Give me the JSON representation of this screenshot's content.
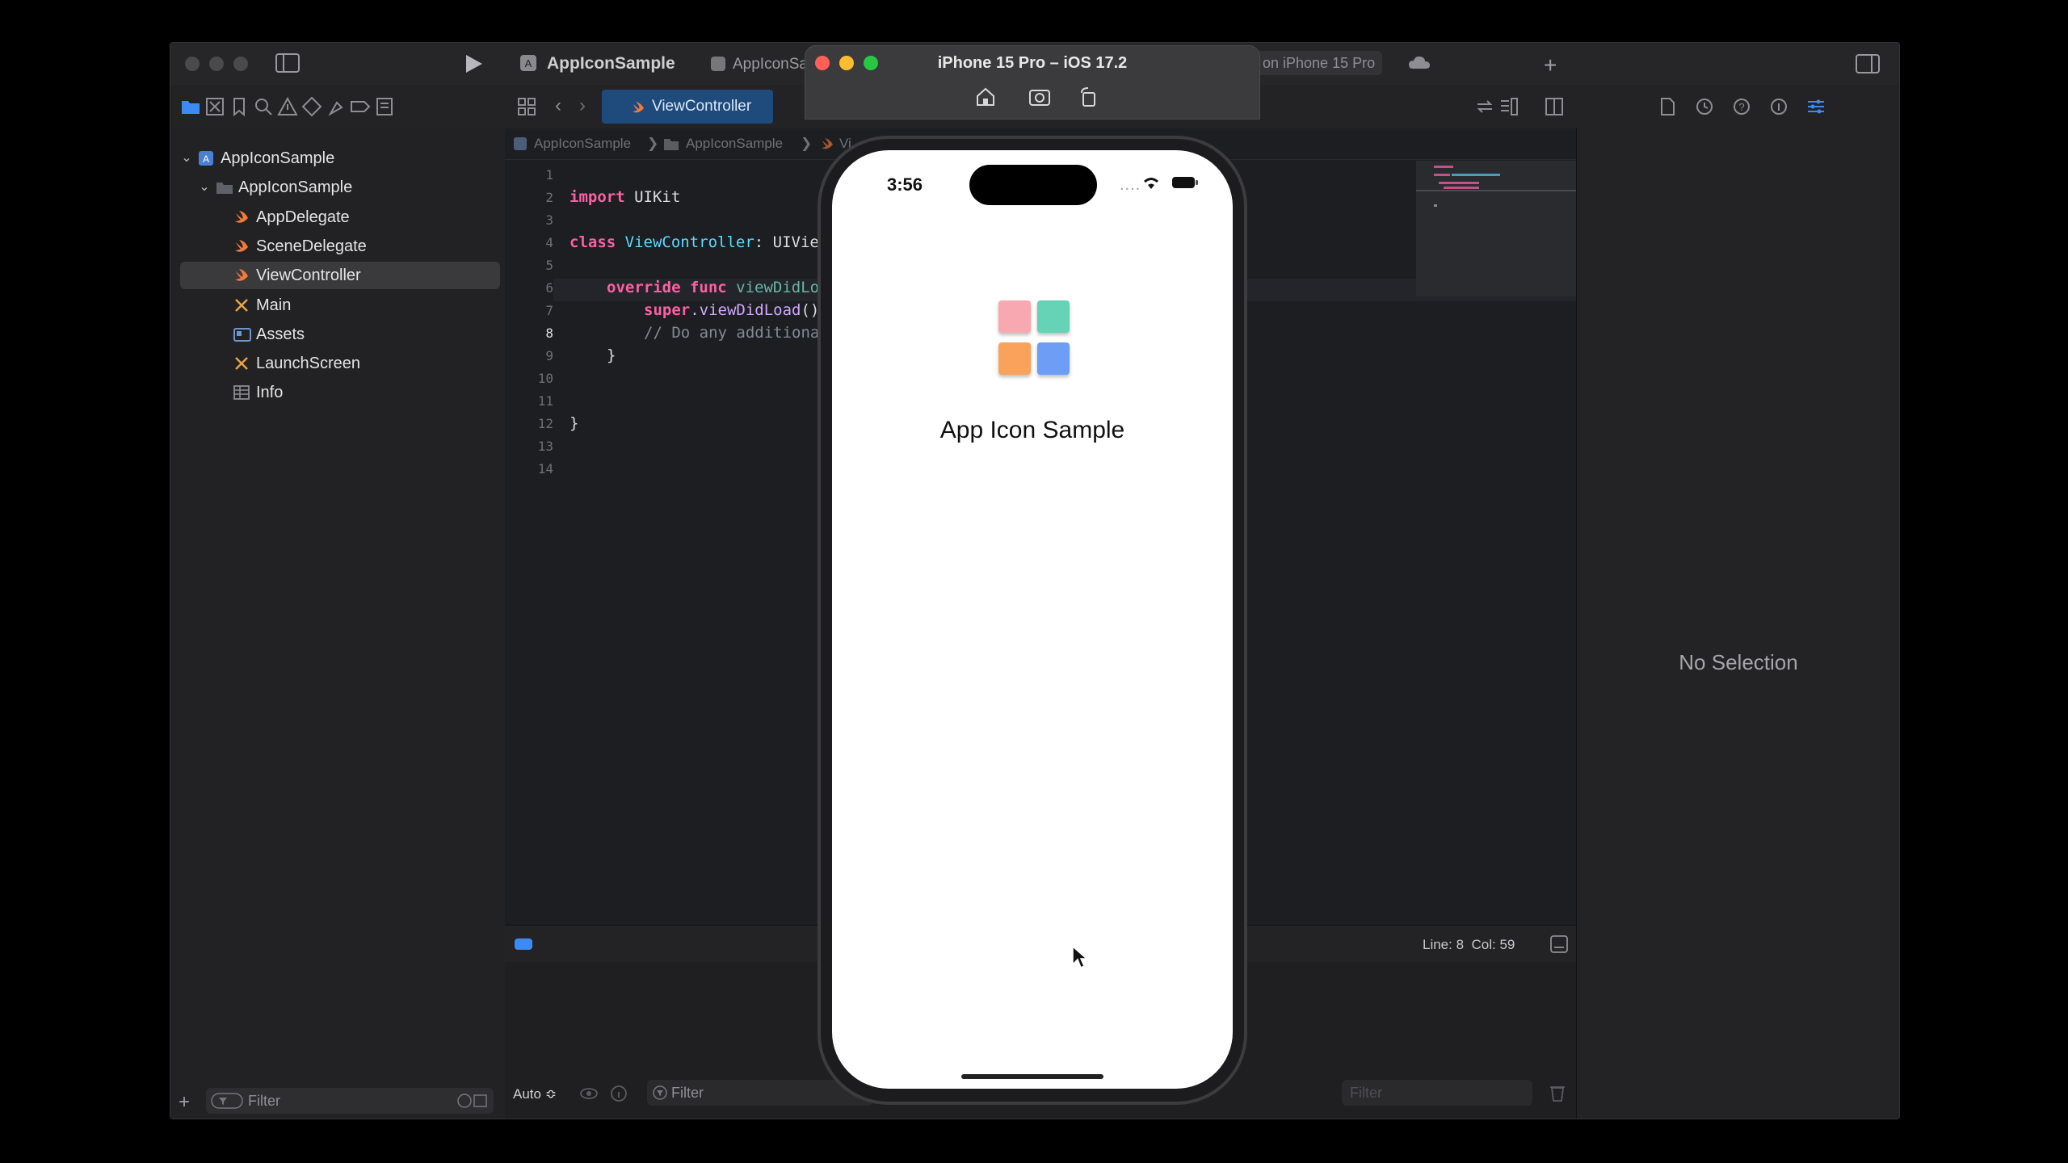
{
  "xcode": {
    "scheme_project": "AppIconSample",
    "scheme_partial": "AppIconSa",
    "destination_partial": "on iPhone 15 Pro",
    "active_tab": "ViewController",
    "jumpbar": [
      "AppIconSample",
      "AppIconSample",
      "Vi"
    ]
  },
  "navigator": {
    "items": [
      {
        "label": "AppIconSample",
        "icon": "project-icon",
        "indent": 0,
        "chevron": "⌄"
      },
      {
        "label": "AppIconSample",
        "icon": "folder-icon",
        "indent": 1,
        "chevron": "⌄"
      },
      {
        "label": "AppDelegate",
        "icon": "swift-file-icon",
        "indent": 2
      },
      {
        "label": "SceneDelegate",
        "icon": "swift-file-icon",
        "indent": 2
      },
      {
        "label": "ViewController",
        "icon": "swift-file-icon",
        "indent": 2,
        "selected": true
      },
      {
        "label": "Main",
        "icon": "storyboard-icon",
        "indent": 2
      },
      {
        "label": "Assets",
        "icon": "assets-icon",
        "indent": 2
      },
      {
        "label": "LaunchScreen",
        "icon": "storyboard-icon",
        "indent": 2
      },
      {
        "label": "Info",
        "icon": "plist-icon",
        "indent": 2
      }
    ],
    "filter_placeholder": "Filter"
  },
  "editor": {
    "line_numbers": [
      "1",
      "2",
      "3",
      "4",
      "5",
      "6",
      "7",
      "8",
      "9",
      "10",
      "11",
      "12",
      "13",
      "14"
    ],
    "current_line": "8",
    "code": {
      "l2_kw": "import",
      "l2_rest": " UIKit",
      "l4_kw": "class",
      "l4_ty": " ViewController",
      "l4_rest": ": UIVie",
      "l6_kw": "override func",
      "l6_fn": " viewDidLo",
      "l7_kw": "super",
      "l7_fn": ".viewDidLoad",
      "l7_rest": "()",
      "l8_cm": "// Do any additiona",
      "l9": "}",
      "l12": "}"
    },
    "status": "Line: 8  Col: 59"
  },
  "debug": {
    "auto_label": "Auto ≎",
    "filter_placeholder": "Filter",
    "filter2_placeholder": "Filter"
  },
  "inspector": {
    "empty_text": "No Selection"
  },
  "simulator": {
    "device_title": "iPhone 15 Pro – iOS 17.2",
    "time": "3:56",
    "signal": "....",
    "app_title": "App Icon Sample",
    "tiles": [
      "#f7a8b0",
      "#66d3b6",
      "#f9a25c",
      "#6c9ef5"
    ]
  }
}
